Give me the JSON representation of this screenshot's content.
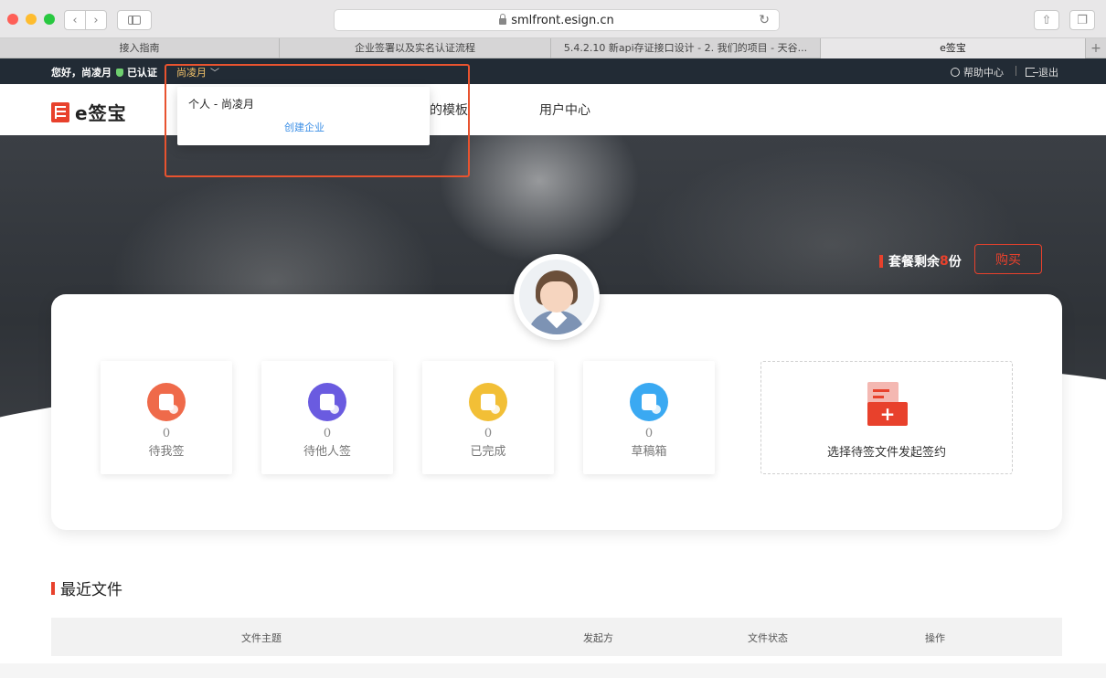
{
  "browser": {
    "url": "smlfront.esign.cn",
    "tabs": [
      {
        "label": "接入指南",
        "active": false
      },
      {
        "label": "企业签署以及实名认证流程",
        "active": false
      },
      {
        "label": "5.4.2.10 新api存证接口设计 - 2. 我们的项目 - 天谷...",
        "active": false
      },
      {
        "label": "e签宝",
        "active": true
      }
    ],
    "new_tab": "+"
  },
  "topbar": {
    "greeting": "您好，尚凌月",
    "verified": "已认证",
    "account": "尚凌月",
    "help": "帮助中心",
    "logout": "退出"
  },
  "header": {
    "logo_text": "e签宝",
    "nav_templates": "的模板",
    "nav_user": "用户中心"
  },
  "dropdown": {
    "personal": "个人 - 尚凌月",
    "create_company": "创建企业"
  },
  "hero": {
    "quota_prefix": "套餐剩余",
    "quota_count": "8",
    "quota_suffix": "份",
    "buy": "购买"
  },
  "stats": [
    {
      "count": "0",
      "label": "待我签"
    },
    {
      "count": "0",
      "label": "待他人签"
    },
    {
      "count": "0",
      "label": "已完成"
    },
    {
      "count": "0",
      "label": "草稿箱"
    }
  ],
  "new_sign": {
    "label": "选择待签文件发起签约"
  },
  "recent": {
    "title": "最近文件",
    "columns": [
      "文件主题",
      "发起方",
      "文件状态",
      "操作"
    ]
  },
  "colors": {
    "brand": "#e8412c",
    "link": "#3a8ee6",
    "topbar": "#222b35"
  }
}
